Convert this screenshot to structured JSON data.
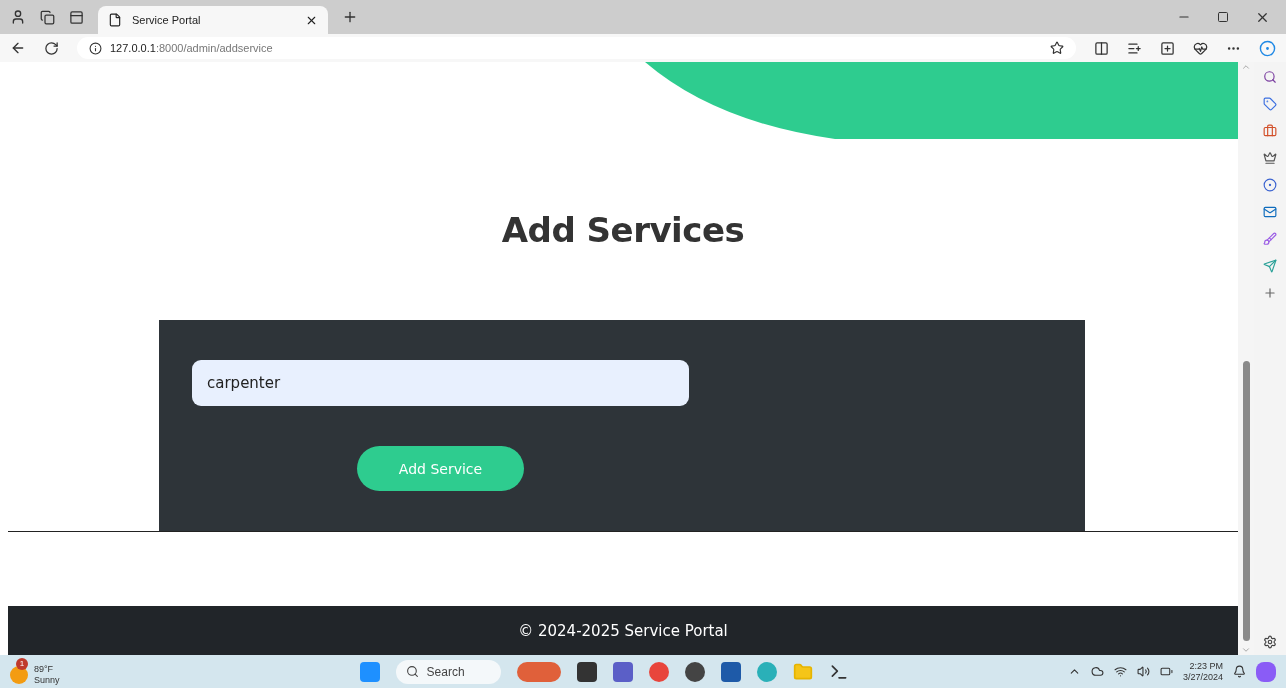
{
  "browser": {
    "tab_title": "Service Portal",
    "url_host": "127.0.0.1",
    "url_rest": ":8000/admin/addservice"
  },
  "page": {
    "heading": "Add Services",
    "service_input": {
      "value": "carpenter"
    },
    "submit_button": "Add Service",
    "footer": "© 2024-2025 Service Portal"
  },
  "taskbar": {
    "weather_badge": "1",
    "temperature": "89°F",
    "condition": "Sunny",
    "search_placeholder": "Search",
    "time": "2:23 PM",
    "date": "3/27/2024"
  }
}
